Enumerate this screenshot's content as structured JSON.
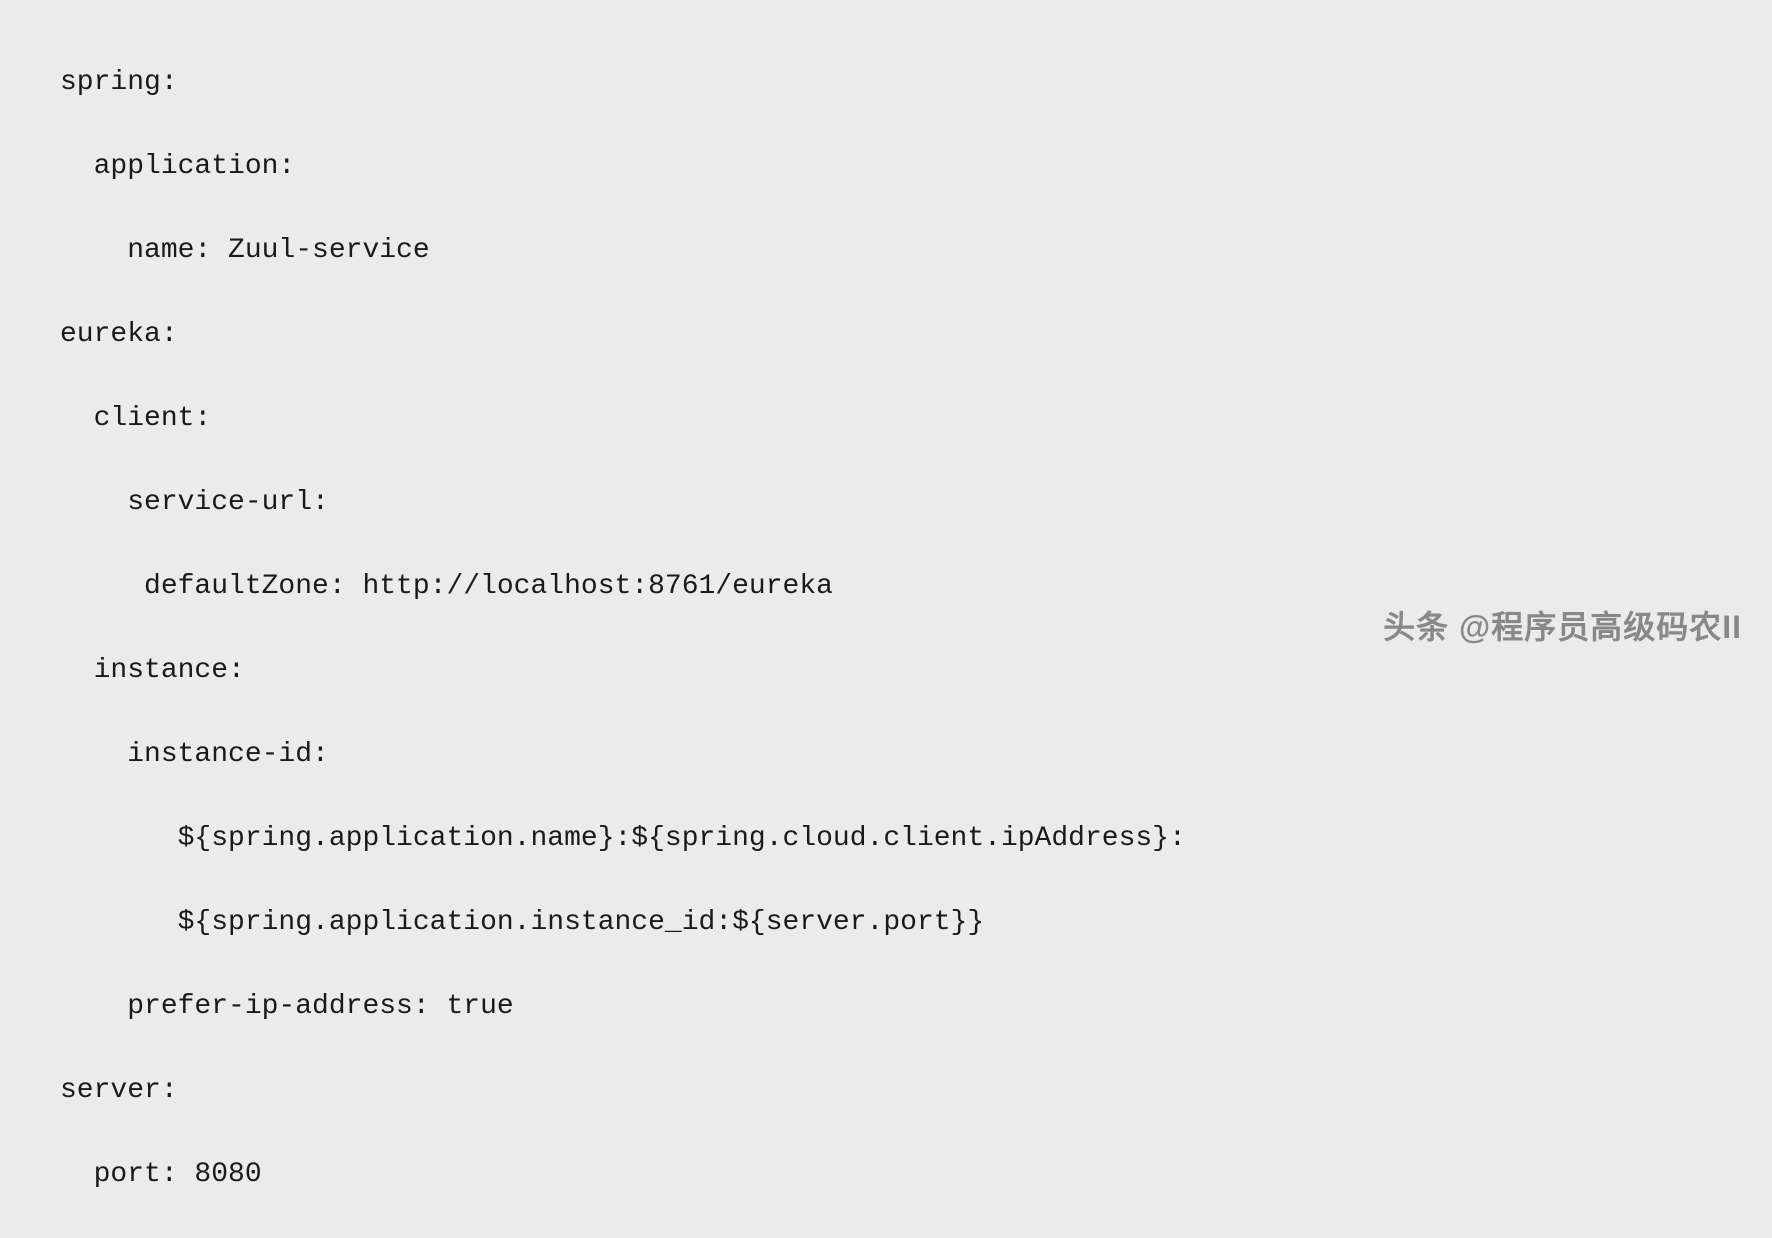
{
  "code": {
    "lines": [
      "spring:",
      "  application:",
      "    name: Zuul-service",
      "eureka:",
      "  client:",
      "    service-url:",
      "     defaultZone: http://localhost:8761/eureka",
      "  instance:",
      "    instance-id:",
      "       ${spring.application.name}:${spring.cloud.client.ipAddress}:",
      "       ${spring.application.instance_id:${server.port}}",
      "    prefer-ip-address: true",
      "server:",
      "  port: 8080"
    ]
  },
  "watermark": {
    "text": "头条 @程序员高级码农II"
  }
}
